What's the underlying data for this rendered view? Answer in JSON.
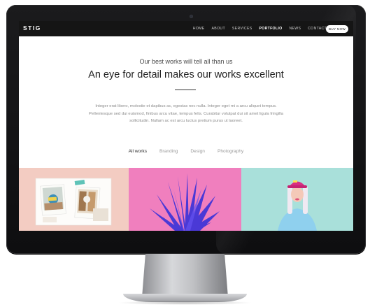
{
  "site": {
    "logo": "STIG",
    "nav": [
      {
        "label": "HOME",
        "active": false
      },
      {
        "label": "ABOUT",
        "active": false
      },
      {
        "label": "SERVICES",
        "active": false
      },
      {
        "label": "PORTFOLIO",
        "active": true
      },
      {
        "label": "NEWS",
        "active": false
      },
      {
        "label": "CONTACT",
        "active": false
      }
    ],
    "cta": "BUY NOW"
  },
  "hero": {
    "tagline": "Our best works will tell all than us",
    "headline": "An eye for detail makes our works excellent",
    "body": "Integer erat libero, molestie et dapibus ac, egestas nec nulla. Integer eget mi a arcu aliquet tempus. Pellentesque sed dui euismod, finibus arcu vitae, tempus felis. Curabitur volutpat dui sit amet ligula fringilla sollicitudin. Nullam ac est arcu luctus pretium purus ut laoreet."
  },
  "filters": [
    {
      "label": "All works",
      "active": true
    },
    {
      "label": "Branding",
      "active": false
    },
    {
      "label": "Design",
      "active": false
    },
    {
      "label": "Photography",
      "active": false
    }
  ],
  "portfolio": [
    {
      "subject": "photo-collage",
      "background": "#f3ccc2"
    },
    {
      "subject": "agave-plant",
      "background": "#f07fbe"
    },
    {
      "subject": "person-in-cap",
      "background": "#a9e0da"
    }
  ],
  "colors": {
    "navbar": "#151515",
    "bezel": "#151517",
    "text_dark": "#1f1f1f",
    "text_muted": "#8a8a8a"
  }
}
